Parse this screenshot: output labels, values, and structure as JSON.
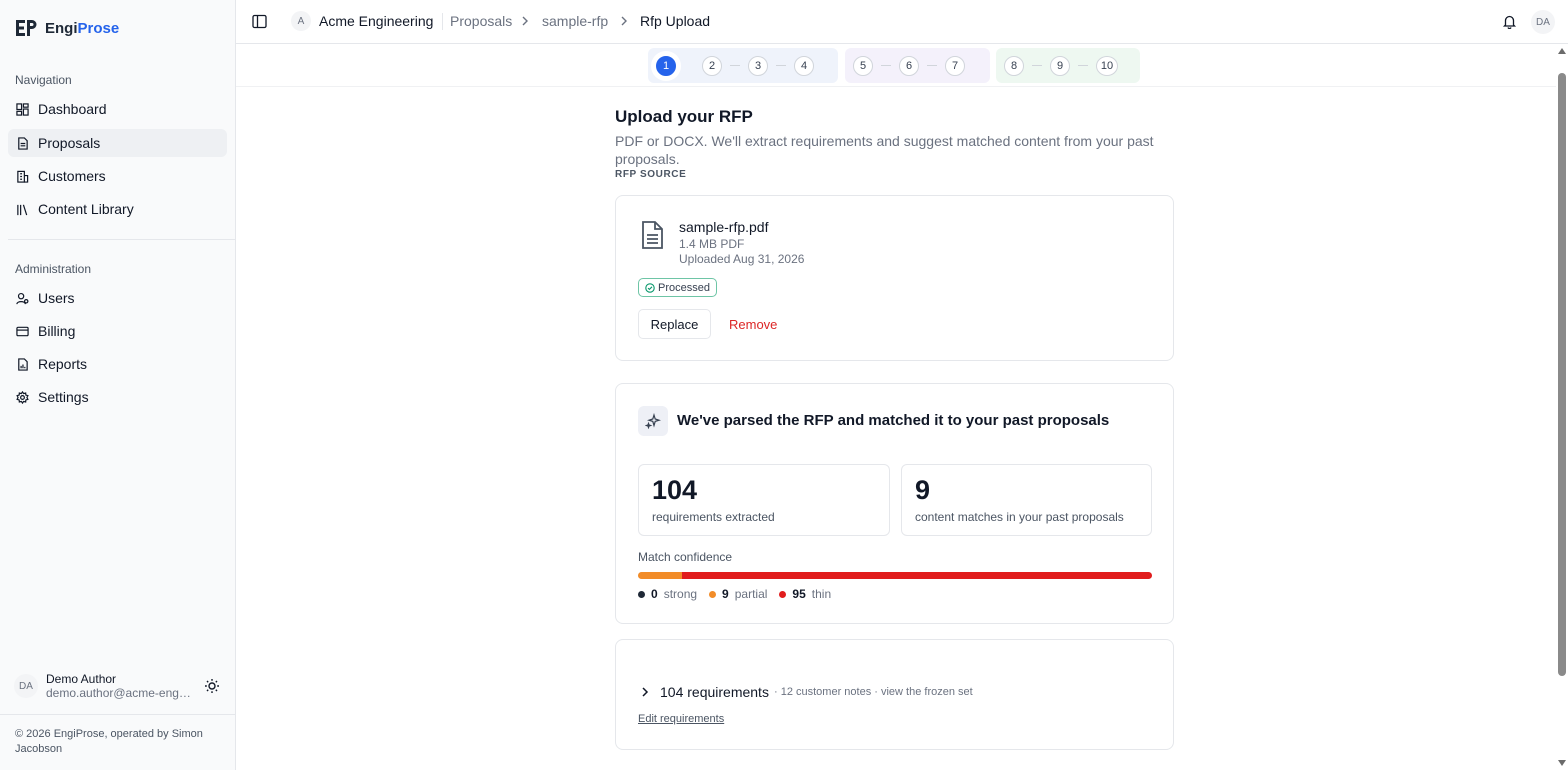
{
  "sidebar": {
    "brand": {
      "prefix": "Engi",
      "accent": "Prose"
    },
    "nav_section_label": "Navigation",
    "nav_items": [
      {
        "label": "Dashboard",
        "icon": "dashboard-icon"
      },
      {
        "label": "Proposals",
        "icon": "document-icon",
        "active": true
      },
      {
        "label": "Customers",
        "icon": "building-icon"
      },
      {
        "label": "Content Library",
        "icon": "library-icon"
      }
    ],
    "admin_section_label": "Administration",
    "admin_items": [
      {
        "label": "Users",
        "icon": "user-icon"
      },
      {
        "label": "Billing",
        "icon": "credit-card-icon"
      },
      {
        "label": "Reports",
        "icon": "report-icon"
      },
      {
        "label": "Settings",
        "icon": "gear-icon"
      }
    ],
    "user": {
      "initials": "DA",
      "name": "Demo Author",
      "email": "demo.author@acme-engineering.com"
    },
    "footer": "© 2026 EngiProse, operated by Simon Jacobson"
  },
  "topbar": {
    "org_initial": "A",
    "org_name": "Acme Engineering",
    "breadcrumbs": [
      "Proposals",
      "sample-rfp",
      "Rfp Upload"
    ],
    "user_initials": "DA"
  },
  "stepper": {
    "groups": [
      {
        "steps": [
          "1",
          "2",
          "3",
          "4"
        ],
        "color": "#eff3fb"
      },
      {
        "steps": [
          "5",
          "6",
          "7"
        ],
        "color": "#f4f1fb"
      },
      {
        "steps": [
          "8",
          "9",
          "10"
        ],
        "color": "#eef8f1"
      }
    ],
    "active_step": "1"
  },
  "page": {
    "title": "Upload your RFP",
    "subtitle": "PDF or DOCX. We'll extract requirements and suggest matched content from your past proposals.",
    "section_label": "RFP SOURCE"
  },
  "file": {
    "name": "sample-rfp.pdf",
    "meta": "1.4 MB PDF",
    "uploaded": "Uploaded Aug 31, 2026",
    "status": "Processed",
    "replace_label": "Replace",
    "remove_label": "Remove"
  },
  "parsed": {
    "title": "We've parsed the RFP and matched it to your past proposals",
    "stats": [
      {
        "value": "104",
        "label": "requirements extracted"
      },
      {
        "value": "9",
        "label": "content matches in your past proposals"
      }
    ],
    "match_confidence_label": "Match confidence",
    "confidence": [
      {
        "count": 0,
        "label": "strong",
        "color": "#1f2937"
      },
      {
        "count": 9,
        "label": "partial",
        "color": "#f28c28"
      },
      {
        "count": 95,
        "label": "thin",
        "color": "#e11d1d"
      }
    ]
  },
  "requirements": {
    "title": "104 requirements",
    "subtitle": "· 12 customer notes · view the frozen set",
    "edit_label": "Edit requirements"
  },
  "colors": {
    "accent": "#2563eb",
    "danger": "#dc2626",
    "success_border": "#6ec5a6"
  }
}
